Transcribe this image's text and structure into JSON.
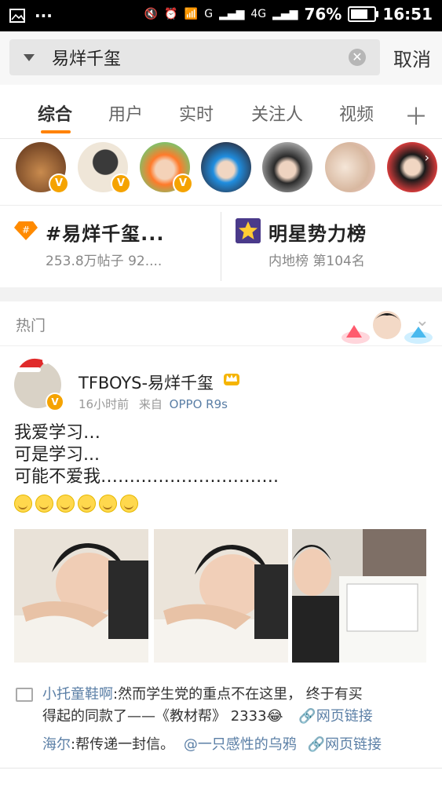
{
  "status_bar": {
    "battery": "76%",
    "time": "16:51",
    "network_1": "G",
    "network_2": "4G",
    "battery_level": 0.76
  },
  "search": {
    "query": "易烊千玺",
    "cancel_label": "取消"
  },
  "tabs": [
    "综合",
    "用户",
    "实时",
    "关注人",
    "视频"
  ],
  "topic_card": {
    "title": "#易烊千玺...",
    "sub": "253.8万帖子  92...."
  },
  "rank_card": {
    "title": "明星势力榜",
    "sub": "内地榜  第104名"
  },
  "hot_label": "热门",
  "post": {
    "author": "TFBOYS-易烊千玺",
    "time": "16小时前",
    "from_label": "来自",
    "source": "OPPO R9s",
    "text": "我爱学习…\n可是学习...\n可能不爱我…………………………."
  },
  "comments": [
    {
      "user": "小托童鞋啊",
      "text_1": ":然而学生党的重点不在这里，  终于有买",
      "text_2": "得起的同款了——《教材帮》  2333😂",
      "link": "网页链接"
    },
    {
      "user": "海尔",
      "text": ":帮传递一封信。",
      "mention": "@一只感性的乌鸦",
      "link": "网页链接"
    }
  ],
  "colors": {
    "accent": "#ff8200",
    "link": "#5b7fa6",
    "verified": "#f5a300"
  }
}
